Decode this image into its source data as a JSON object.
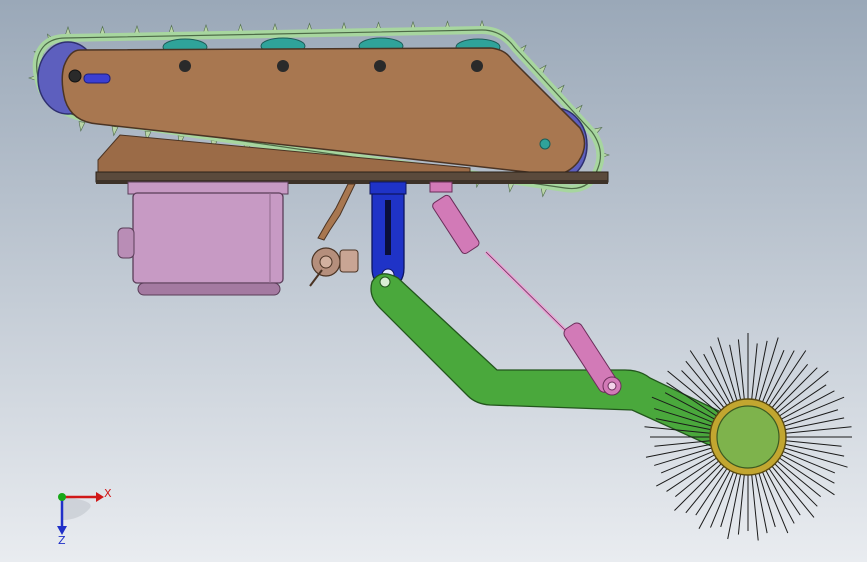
{
  "viewport": {
    "background_top": "#9aa8b8",
    "background_bottom": "#e9ecf0"
  },
  "colors": {
    "crawler_plate": "#a87750",
    "crawler_plate_dark": "#8e5f3d",
    "track_belt": "#9ccf94",
    "track_spike": "#b9d4a7",
    "idler_wheel": "#5d5fbe",
    "roller_teal": "#2fa39a",
    "base_plate": "#5a4a3c",
    "gearbox": "#c79ac4",
    "gearbox_dark": "#a47aa1",
    "bracket": "#a87750",
    "blue_slider": "#1f33c7",
    "green_arm": "#4aa83c",
    "pink_cylinder": "#d27ab7",
    "pink_rod": "#e7a6d4",
    "brush_hub_outer": "#c2a630",
    "brush_hub_inner": "#7eb34c",
    "bristle": "#1a1a1a",
    "axis_x": "#d01818",
    "axis_y": "#18a818",
    "axis_z": "#2030c8"
  },
  "icons": {
    "triad": "coordinate-triad-icon"
  },
  "triad": {
    "x_label": "X",
    "z_label": "Z"
  }
}
